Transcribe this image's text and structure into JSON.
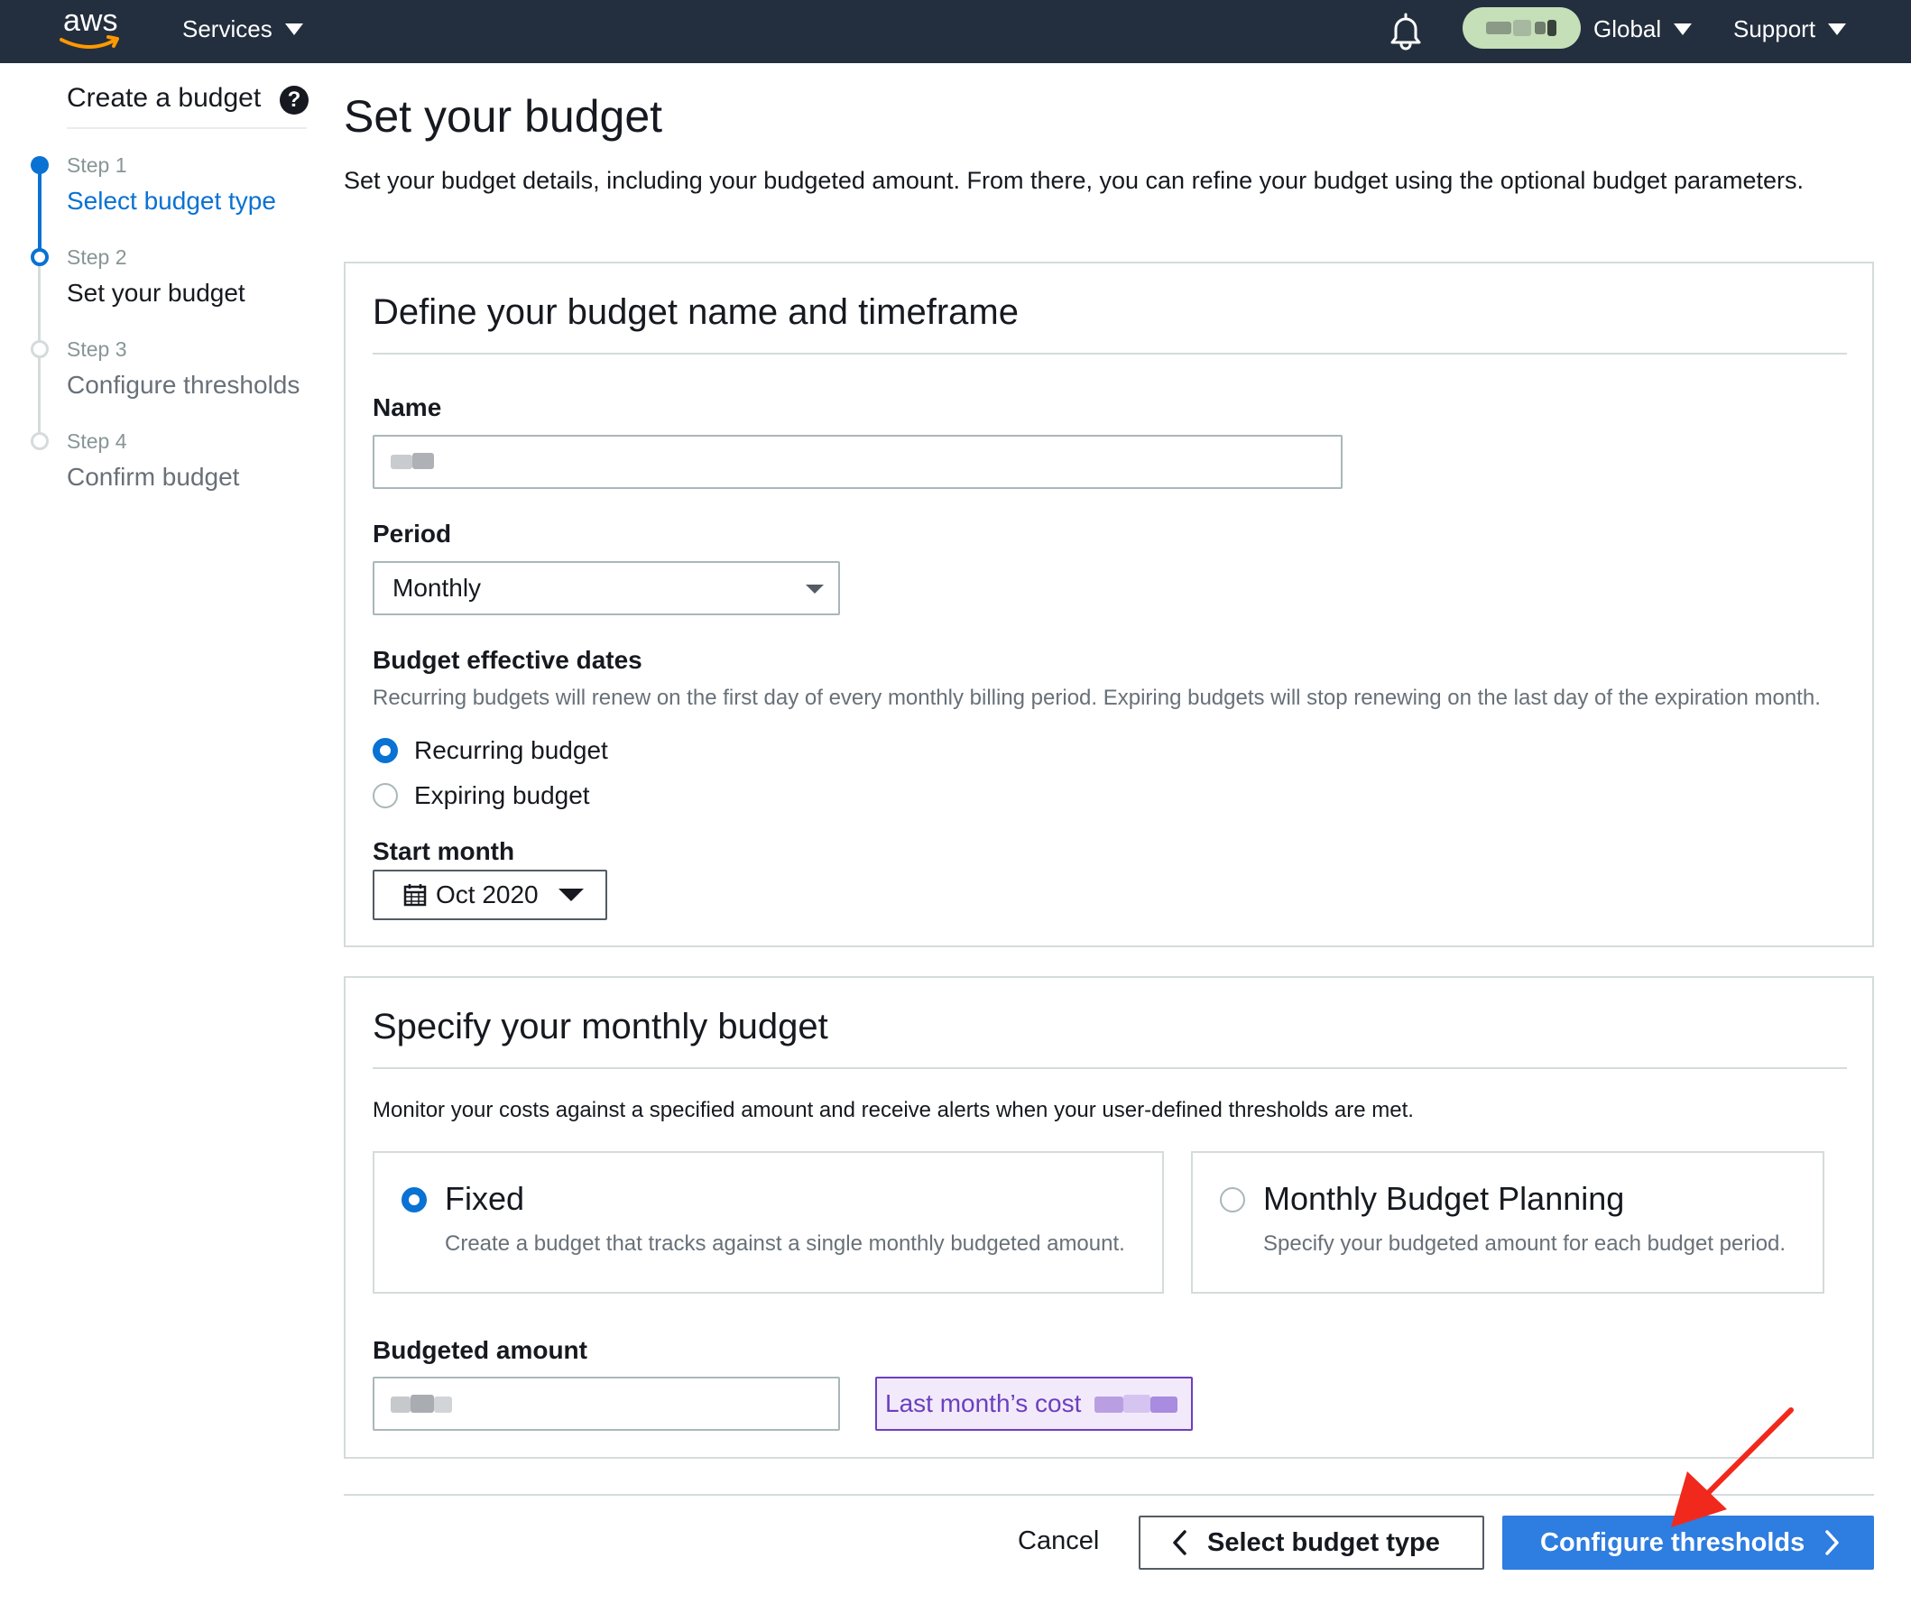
{
  "topnav": {
    "logo_text": "aws",
    "services_label": "Services",
    "region_label": "Global",
    "support_label": "Support",
    "bell_icon": "notification-bell-icon",
    "account_pill_color": "#c5dfb8"
  },
  "sidebar": {
    "title": "Create a budget",
    "steps": [
      {
        "num": "Step 1",
        "label": "Select budget type",
        "state": "completed"
      },
      {
        "num": "Step 2",
        "label": "Set your budget",
        "state": "current"
      },
      {
        "num": "Step 3",
        "label": "Configure thresholds",
        "state": "upcoming"
      },
      {
        "num": "Step 4",
        "label": "Confirm budget",
        "state": "upcoming"
      }
    ]
  },
  "main": {
    "title": "Set your budget",
    "description": "Set your budget details, including your budgeted amount. From there, you can refine your budget using the optional budget parameters."
  },
  "panel_define": {
    "heading": "Define your budget name and timeframe",
    "name_label": "Name",
    "period_label": "Period",
    "period_value": "Monthly",
    "dates_label": "Budget effective dates",
    "dates_hint": "Recurring budgets will renew on the first day of every monthly billing period. Expiring budgets will stop renewing on the last day of the expiration month.",
    "radio_recurring": "Recurring budget",
    "radio_expiring": "Expiring budget",
    "selected_type": "Recurring budget",
    "start_month_label": "Start month",
    "start_month_value": "Oct 2020"
  },
  "panel_amount": {
    "heading": "Specify your monthly budget",
    "description": "Monitor your costs against a specified amount and receive alerts when your user-defined thresholds are met.",
    "tile_fixed_title": "Fixed",
    "tile_fixed_desc": "Create a budget that tracks against a single monthly budgeted amount.",
    "tile_planning_title": "Monthly Budget Planning",
    "tile_planning_desc": "Specify your budgeted amount for each budget period.",
    "selected_tile": "Fixed",
    "amount_label": "Budgeted amount",
    "last_cost_label": "Last month’s cost"
  },
  "footer": {
    "cancel_label": "Cancel",
    "prev_label": "Select budget type",
    "next_label": "Configure thresholds"
  },
  "colors": {
    "nav_bg": "#232f3e",
    "accent_blue": "#0972d3",
    "primary_button": "#2e7de1",
    "last_cost_purple": "#6b3fbd",
    "annotation_arrow": "#f0291c"
  }
}
